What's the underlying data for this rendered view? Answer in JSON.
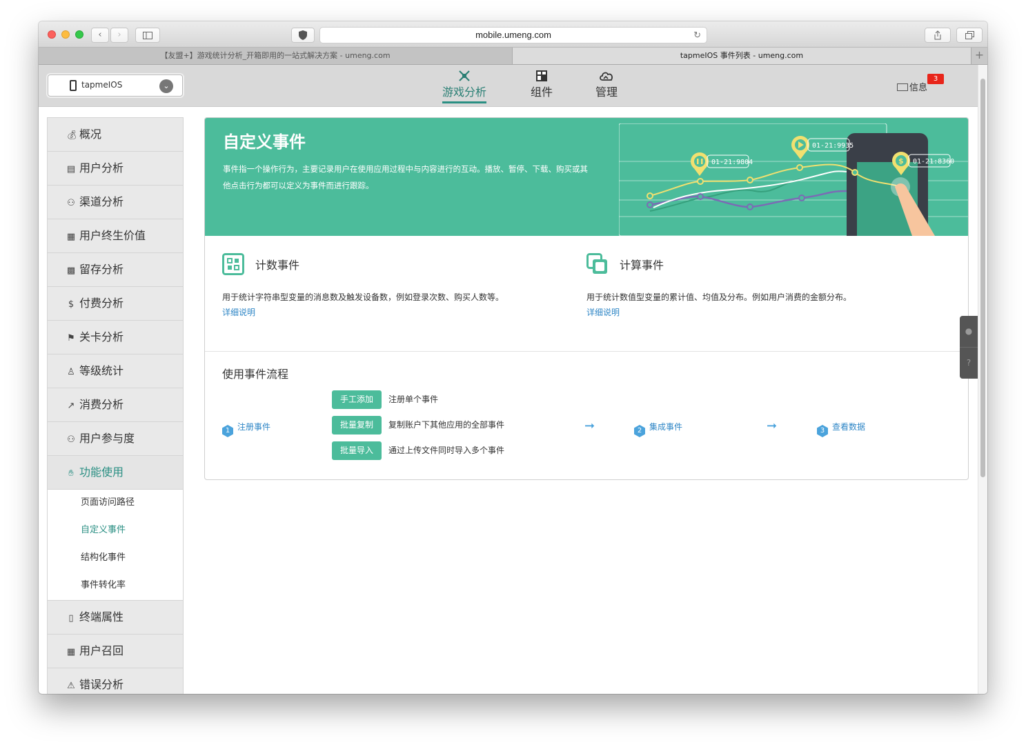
{
  "browser": {
    "url": "mobile.umeng.com",
    "tabs": [
      {
        "label": "【友盟+】游戏统计分析_开箱即用的一站式解决方案 - umeng.com"
      },
      {
        "label": "tapmeIOS 事件列表 - umeng.com"
      }
    ]
  },
  "header": {
    "app_name": "tapmeIOS",
    "nav": [
      {
        "label": "游戏分析",
        "active": true
      },
      {
        "label": "组件"
      },
      {
        "label": "管理"
      }
    ],
    "messages_label": "信息",
    "messages_count": "3"
  },
  "sidebar": {
    "items": [
      {
        "label": "概况",
        "icon": "money-bag-icon"
      },
      {
        "label": "用户分析",
        "icon": "bar-chart-icon"
      },
      {
        "label": "渠道分析",
        "icon": "users-icon"
      },
      {
        "label": "用户终生价值",
        "icon": "value-icon"
      },
      {
        "label": "留存分析",
        "icon": "grid-icon"
      },
      {
        "label": "付费分析",
        "icon": "coins-icon"
      },
      {
        "label": "关卡分析",
        "icon": "flag-icon"
      },
      {
        "label": "等级统计",
        "icon": "level-icon"
      },
      {
        "label": "消费分析",
        "icon": "trend-icon"
      },
      {
        "label": "用户参与度",
        "icon": "users-icon"
      },
      {
        "label": "功能使用",
        "icon": "hand-icon",
        "active": true
      }
    ],
    "sub_items": [
      {
        "label": "页面访问路径"
      },
      {
        "label": "自定义事件",
        "current": true
      },
      {
        "label": "结构化事件"
      },
      {
        "label": "事件转化率"
      }
    ],
    "items_after": [
      {
        "label": "终端属性",
        "icon": "tablet-icon"
      },
      {
        "label": "用户召回",
        "icon": "recall-icon"
      },
      {
        "label": "错误分析",
        "icon": "warning-icon"
      }
    ]
  },
  "hero": {
    "title": "自定义事件",
    "description": "事件指一个操作行为，主要记录用户在使用应用过程中与内容进行的互动。播放、暂停、下载、购买或其他点击行为都可以定义为事件而进行跟踪。",
    "callouts": [
      "01-21:9804",
      "01-21:9935",
      "01-21:8360"
    ]
  },
  "cards": [
    {
      "title": "计数事件",
      "desc": "用于统计字符串型变量的消息数及触发设备数，例如登录次数、购买人数等。",
      "link": "详细说明"
    },
    {
      "title": "计算事件",
      "desc": "用于统计数值型变量的累计值、均值及分布。例如用户消费的金额分布。",
      "link": "详细说明"
    }
  ],
  "flow": {
    "title": "使用事件流程",
    "steps": [
      {
        "num": "1",
        "label": "注册事件"
      },
      {
        "num": "2",
        "label": "集成事件"
      },
      {
        "num": "3",
        "label": "查看数据"
      }
    ],
    "methods": [
      {
        "button": "手工添加",
        "desc": "注册单个事件"
      },
      {
        "button": "批量复制",
        "desc": "复制账户下其他应用的全部事件"
      },
      {
        "button": "批量导入",
        "desc": "通过上传文件同时导入多个事件"
      }
    ]
  },
  "colors": {
    "accent": "#4cbc9b",
    "active_text": "#2a8f83",
    "link": "#2e86c6",
    "badge": "#e8251a"
  }
}
